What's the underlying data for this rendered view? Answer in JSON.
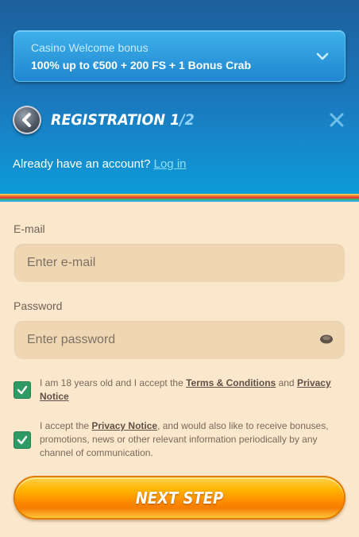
{
  "bonus": {
    "title": "Casino Welcome bonus",
    "description": "100% up to €500 + 200 FS + 1 Bonus Crab"
  },
  "registration": {
    "title": "REGISTRATION 1",
    "step_separator": "/",
    "step_total": "2"
  },
  "account": {
    "prompt": "Already have an account?",
    "login_label": "Log in"
  },
  "form": {
    "email_label": "E-mail",
    "email_placeholder": "Enter e-mail",
    "email_value": "",
    "password_label": "Password",
    "password_placeholder": "Enter password",
    "password_value": ""
  },
  "consents": [
    {
      "checked": true,
      "text_before": "I am 18 years old and I accept the ",
      "link1": "Terms & Conditions",
      "text_middle": " and ",
      "link2": "Privacy Notice"
    },
    {
      "checked": true,
      "text_before": "I accept the ",
      "link1": "Privacy Notice",
      "text_after": ", and would also like to receive bonuses, promotions, news or other relevant information periodically by any channel of communication."
    }
  ],
  "next_button": "NEXT STEP",
  "colors": {
    "header_top": "#1d5f9c",
    "header_bottom": "#0e9bd9",
    "background": "#fbe7cb",
    "checkbox": "#2f9a64",
    "cta": "#ff9100",
    "stripes": [
      "#f7c24a",
      "#ee6a2f",
      "#e83b3b",
      "#3ab56e",
      "#36a6e0"
    ]
  }
}
